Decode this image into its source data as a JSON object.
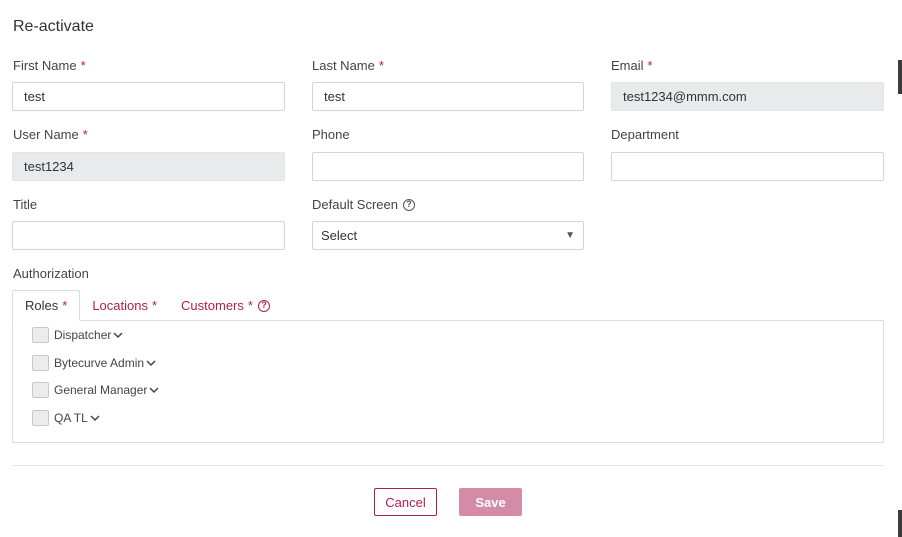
{
  "dialog": {
    "title": "Re-activate",
    "required_marker": "*"
  },
  "fields": {
    "first_name": {
      "label": "First Name",
      "value": "test",
      "required": true
    },
    "last_name": {
      "label": "Last Name",
      "value": "test",
      "required": true
    },
    "email": {
      "label": "Email",
      "value": "test1234@mmm.com",
      "required": true,
      "disabled": true
    },
    "user_name": {
      "label": "User Name",
      "value": "test1234",
      "required": true,
      "disabled": true
    },
    "phone": {
      "label": "Phone",
      "value": ""
    },
    "department": {
      "label": "Department",
      "value": ""
    },
    "title": {
      "label": "Title",
      "value": ""
    },
    "default_screen": {
      "label": "Default Screen",
      "selected": "Select"
    }
  },
  "authorization": {
    "label": "Authorization",
    "tabs": [
      {
        "label": "Roles",
        "active": true
      },
      {
        "label": "Locations",
        "active": false
      },
      {
        "label": "Customers",
        "active": false
      }
    ],
    "roles": [
      {
        "label": "Dispatcher",
        "checked": false
      },
      {
        "label": "Bytecurve Admin",
        "checked": false
      },
      {
        "label": "General Manager",
        "checked": false
      },
      {
        "label": "QA TL",
        "checked": false
      }
    ]
  },
  "footer": {
    "cancel_label": "Cancel",
    "save_label": "Save"
  },
  "colors": {
    "accent": "#b01e4e",
    "save_button": "#d48ba5",
    "disabled_field": "#e9eaec"
  },
  "icons": {
    "help": "help-circle-icon",
    "caret": "caret-down-icon",
    "chevron": "chevron-down-icon"
  }
}
